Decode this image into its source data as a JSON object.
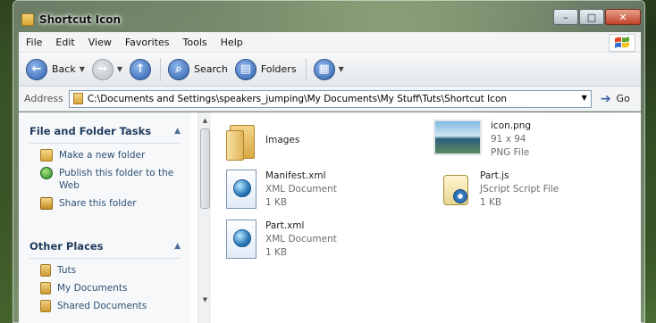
{
  "window": {
    "title": "Shortcut Icon",
    "controls": {
      "minimize": "–",
      "maximize": "□",
      "close": "✕"
    }
  },
  "menubar": {
    "items": [
      "File",
      "Edit",
      "View",
      "Favorites",
      "Tools",
      "Help"
    ]
  },
  "toolbar": {
    "back_label": "Back",
    "search_label": "Search",
    "folders_label": "Folders"
  },
  "address": {
    "label": "Address",
    "value": "C:\\Documents and Settings\\speakers_jumping\\My Documents\\My Stuff\\Tuts\\Shortcut Icon",
    "go_label": "Go"
  },
  "sidebar": {
    "file_folder_tasks": {
      "title": "File and Folder Tasks",
      "tasks": [
        {
          "label": "Make a new folder",
          "icon": "new-folder-icon"
        },
        {
          "label": "Publish this folder to the Web",
          "icon": "publish-web-icon"
        },
        {
          "label": "Share this folder",
          "icon": "share-folder-icon"
        }
      ]
    },
    "other_places": {
      "title": "Other Places",
      "places": [
        {
          "label": "Tuts",
          "icon": "folder-icon"
        },
        {
          "label": "My Documents",
          "icon": "my-documents-icon"
        },
        {
          "label": "Shared Documents",
          "icon": "shared-folder-icon"
        }
      ]
    }
  },
  "files": [
    {
      "name": "Images",
      "type": "",
      "size": "",
      "icon": "folder-icon"
    },
    {
      "name": "icon.png",
      "type": "PNG File",
      "size": "91 x 94",
      "icon": "png-thumbnail"
    },
    {
      "name": "Manifest.xml",
      "type": "XML Document",
      "size": "1 KB",
      "icon": "xml-document-icon"
    },
    {
      "name": "Part.js",
      "type": "JScript Script File",
      "size": "1 KB",
      "icon": "jscript-file-icon"
    },
    {
      "name": "Part.xml",
      "type": "XML Document",
      "size": "1 KB",
      "icon": "xml-document-icon"
    }
  ]
}
